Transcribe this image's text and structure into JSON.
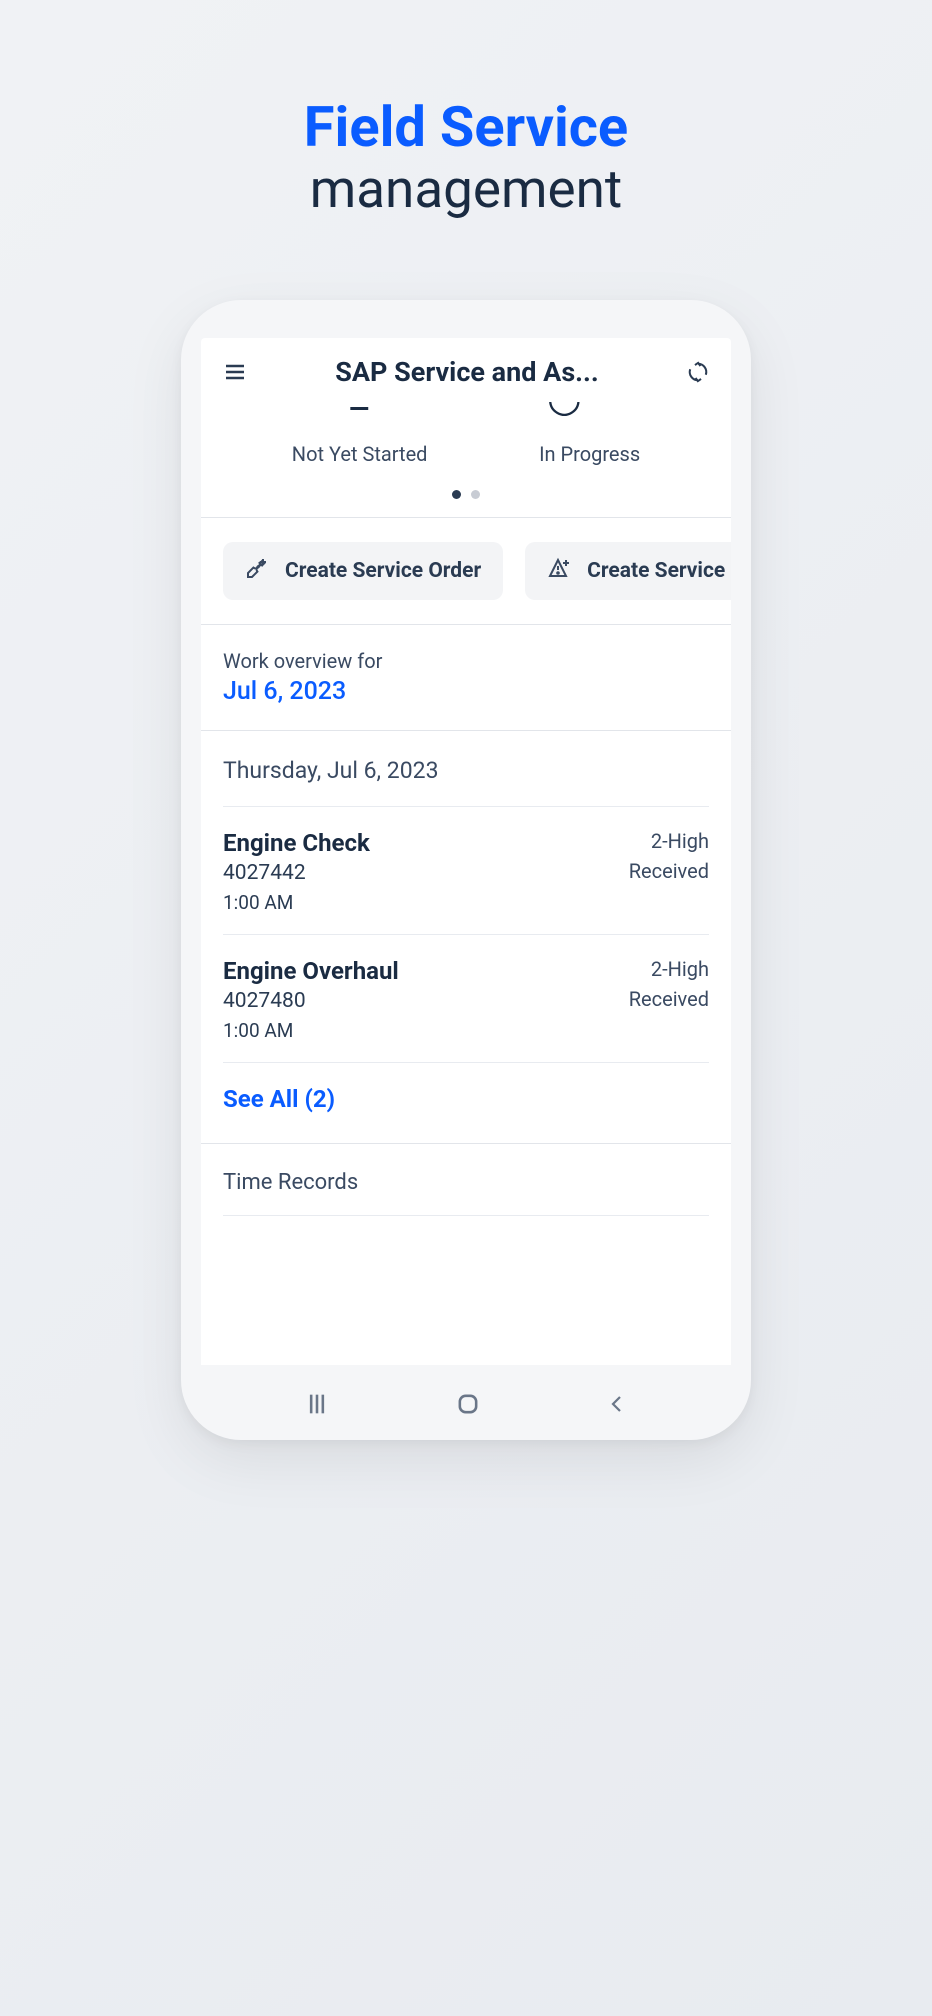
{
  "marketing": {
    "title_line1": "Field Service",
    "title_line2": "management"
  },
  "header": {
    "title": "SAP Service and As..."
  },
  "status_tabs": {
    "labels": [
      "Not Yet Started",
      "In Progress"
    ]
  },
  "actions": {
    "create_order": "Create Service Order",
    "create_service": "Create Service"
  },
  "overview": {
    "label": "Work overview for",
    "date": "Jul 6, 2023"
  },
  "day_header": "Thursday, Jul 6, 2023",
  "work_items": [
    {
      "title": "Engine Check",
      "id": "4027442",
      "time": "1:00 AM",
      "priority": "2-High",
      "status": "Received"
    },
    {
      "title": "Engine Overhaul",
      "id": "4027480",
      "time": "1:00 AM",
      "priority": "2-High",
      "status": "Received"
    }
  ],
  "see_all": "See All (2)",
  "time_records": "Time Records"
}
